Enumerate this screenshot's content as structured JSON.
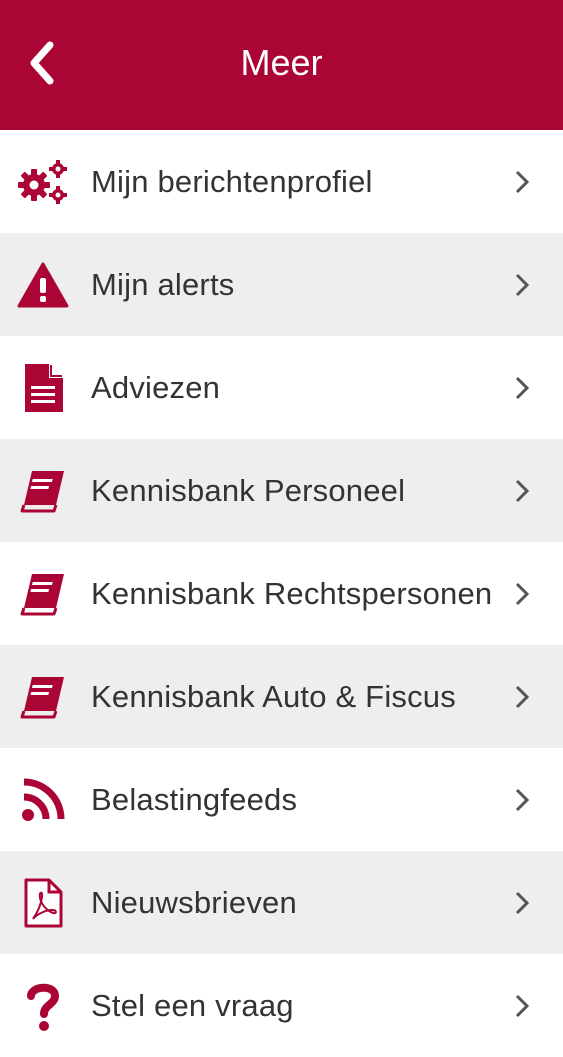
{
  "header": {
    "title": "Meer"
  },
  "colors": {
    "accent": "#ab0535",
    "row_alt": "#eeeeee",
    "text": "#333333"
  },
  "items": [
    {
      "label": "Mijn berichtenprofiel",
      "icon": "gears-icon"
    },
    {
      "label": "Mijn alerts",
      "icon": "warning-icon"
    },
    {
      "label": "Adviezen",
      "icon": "document-icon"
    },
    {
      "label": "Kennisbank Personeel",
      "icon": "book-icon"
    },
    {
      "label": "Kennisbank Rechtspersonen",
      "icon": "book-icon"
    },
    {
      "label": "Kennisbank Auto & Fiscus",
      "icon": "book-icon"
    },
    {
      "label": "Belastingfeeds",
      "icon": "rss-icon"
    },
    {
      "label": "Nieuwsbrieven",
      "icon": "pdf-icon"
    },
    {
      "label": "Stel een vraag",
      "icon": "question-icon"
    }
  ]
}
